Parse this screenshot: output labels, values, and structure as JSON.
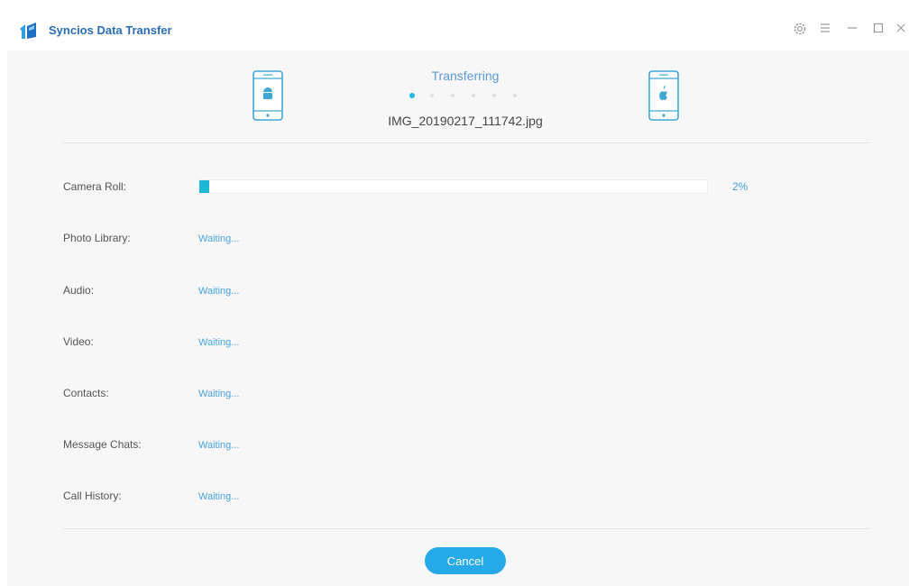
{
  "window": {
    "title": "Syncios Data Transfer",
    "controls": {
      "settings_icon": "gear-icon",
      "menu_icon": "menu-icon",
      "minimize_icon": "minimize-icon",
      "maximize_icon": "maximize-icon",
      "close_icon": "close-icon"
    }
  },
  "transfer": {
    "status": "Transferring",
    "current_file": "IMG_20190217_111742.jpg",
    "source_device_icon": "android-phone-icon",
    "target_device_icon": "iphone-icon",
    "step_dots": 6,
    "active_dot": 0
  },
  "items": [
    {
      "label": "Camera Roll:",
      "status": null,
      "progress": 0.02,
      "percent": "2%"
    },
    {
      "label": "Photo Library:",
      "status": "Waiting..."
    },
    {
      "label": "Audio:",
      "status": "Waiting..."
    },
    {
      "label": "Video:",
      "status": "Waiting..."
    },
    {
      "label": "Contacts:",
      "status": "Waiting..."
    },
    {
      "label": "Message Chats:",
      "status": "Waiting..."
    },
    {
      "label": "Call History:",
      "status": "Waiting..."
    }
  ],
  "footer": {
    "cancel_label": "Cancel"
  },
  "colors": {
    "accent": "#25a9e8",
    "progress": "#1fb7d6",
    "title": "#2a6db5"
  }
}
